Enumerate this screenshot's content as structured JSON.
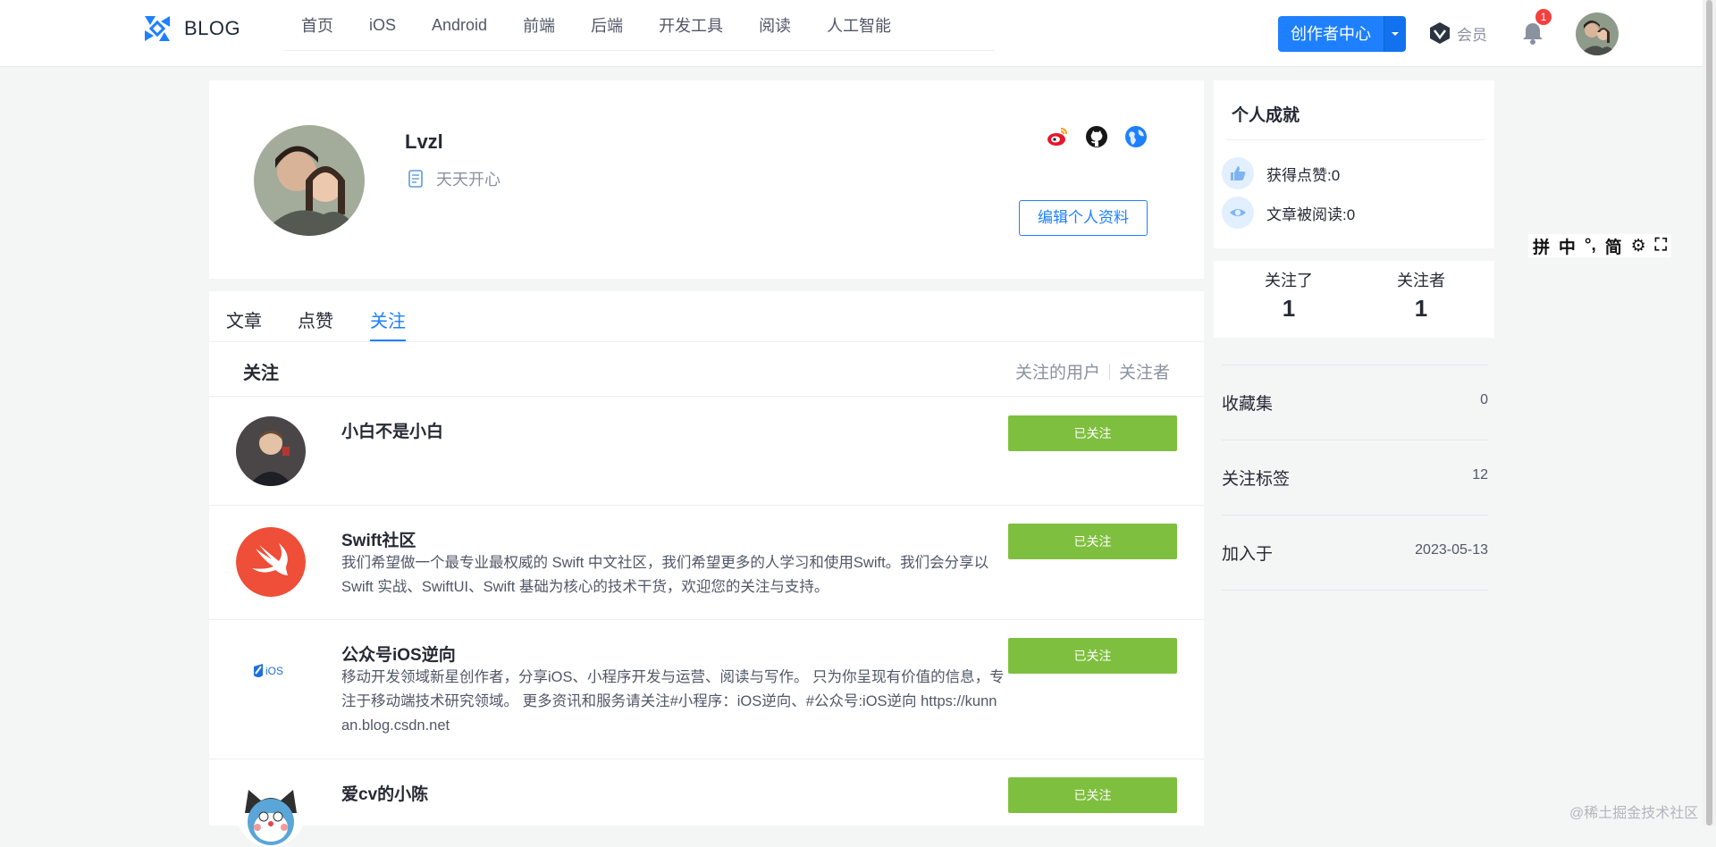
{
  "header": {
    "logo_text": "BLOG",
    "nav": [
      "首页",
      "iOS",
      "Android",
      "前端",
      "后端",
      "开发工具",
      "阅读",
      "人工智能"
    ],
    "creator_button": "创作者中心",
    "vip_label": "会员",
    "notification_count": "1",
    "accent_color": "#1e80ff"
  },
  "profile": {
    "name": "Lvzl",
    "intro": "天天开心",
    "edit_button": "编辑个人资料",
    "socials": [
      "weibo-icon",
      "github-icon",
      "website-icon"
    ]
  },
  "tabs": {
    "items": [
      "文章",
      "点赞",
      "关注"
    ],
    "active": "关注"
  },
  "follow_section": {
    "title": "关注",
    "link_users": "关注的用户",
    "link_followers": "关注者",
    "button_color": "#7fbf3f",
    "users": [
      {
        "name": "小白不是小白",
        "desc": "",
        "button": "已关注"
      },
      {
        "name": "Swift社区",
        "desc": "我们希望做一个最专业最权威的 Swift 中文社区，我们希望更多的人学习和使用Swift。我们会分享以 Swift 实战、SwiftUI、Swift 基础为核心的技术干货，欢迎您的关注与支持。",
        "button": "已关注"
      },
      {
        "name": "公众号iOS逆向",
        "desc": "移动开发领域新星创作者，分享iOS、小程序开发与运营、阅读与写作。 只为你呈现有价值的信息，专注于移动端技术研究领域。 更多资讯和服务请关注#小程序：iOS逆向、#公众号:iOS逆向 https://kunnan.blog.csdn.net",
        "button": "已关注",
        "logo_text": "iOS"
      },
      {
        "name": "爱cv的小陈",
        "desc": "",
        "button": "已关注"
      }
    ]
  },
  "sidebar": {
    "achievements_title": "个人成就",
    "likes_label": "获得点赞:0",
    "reads_label": "文章被阅读:0",
    "following_label": "关注了",
    "following_count": "1",
    "followers_label": "关注者",
    "followers_count": "1",
    "stats": [
      {
        "label": "收藏集",
        "value": "0"
      },
      {
        "label": "关注标签",
        "value": "12"
      },
      {
        "label": "加入于",
        "value": "2023-05-13"
      }
    ]
  },
  "ime_toolbar": [
    "拼",
    "中",
    "°,",
    "简",
    "⚙",
    "⛶"
  ],
  "watermark": "@稀土掘金技术社区"
}
